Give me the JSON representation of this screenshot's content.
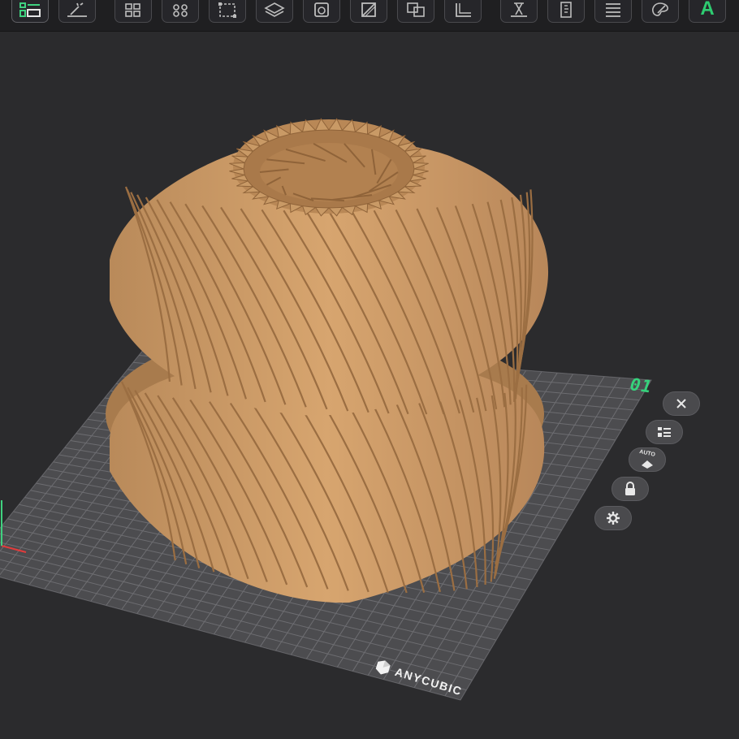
{
  "toolbar": {
    "tools": [
      {
        "icon": "layout-list-icon",
        "active": true
      },
      {
        "icon": "wand-icon"
      },
      {
        "icon": "arrange-grid-icon"
      },
      {
        "icon": "gear-grid-icon"
      },
      {
        "icon": "bounding-box-icon"
      },
      {
        "icon": "layers-cube-icon"
      },
      {
        "icon": "hollow-square-icon"
      },
      {
        "icon": "slash-box-icon"
      },
      {
        "icon": "boolean-overlap-icon"
      },
      {
        "icon": "corner-bracket-icon"
      },
      {
        "icon": "support-tower-icon"
      },
      {
        "icon": "ruler-file-icon"
      },
      {
        "icon": "slice-lines-icon"
      },
      {
        "icon": "palette-icon"
      },
      {
        "icon": "anycubic-a-icon"
      }
    ],
    "anycubic_letter": "A",
    "accent_color": "#2ecc71"
  },
  "viewport": {
    "plate_label": "01",
    "plate_label_color": "#36d27c",
    "model_color": "#c99a66",
    "bed_color": "#4c4c4f",
    "grid_color": "#6d6d71",
    "brand": "ANYCUBIC",
    "side_buttons": [
      {
        "icon": "close-icon"
      },
      {
        "icon": "list-settings-icon"
      },
      {
        "icon": "auto-layout-icon",
        "label": "AUTO"
      },
      {
        "icon": "lock-icon"
      },
      {
        "icon": "gear-icon"
      }
    ]
  }
}
